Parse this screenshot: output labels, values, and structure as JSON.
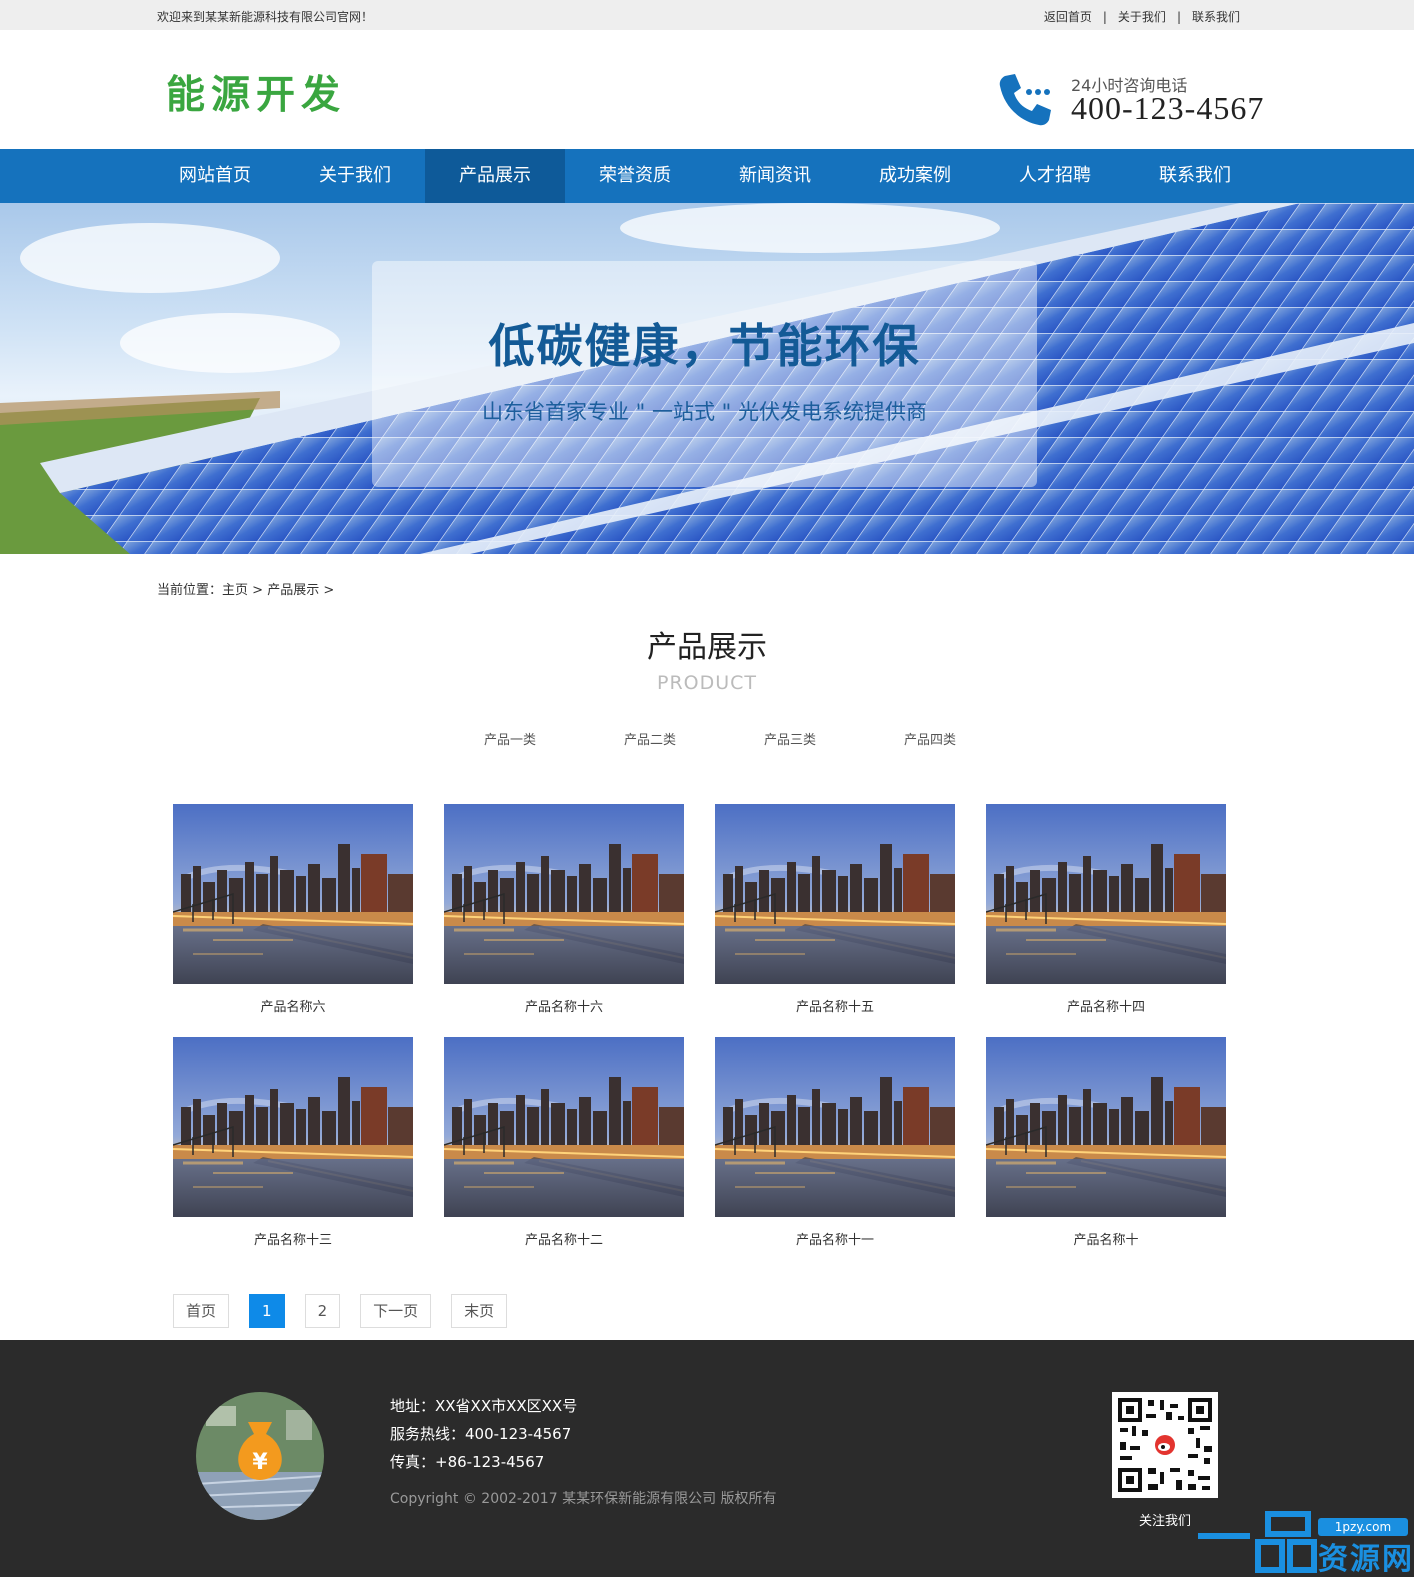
{
  "topbar": {
    "welcome": "欢迎来到某某新能源科技有限公司官网！",
    "links": [
      "返回首页",
      "关于我们",
      "联系我们"
    ],
    "separator": "|"
  },
  "header": {
    "logo": "能源开发",
    "phone_label": "24小时咨询电话",
    "phone_number": "400-123-4567"
  },
  "nav": {
    "items": [
      "网站首页",
      "关于我们",
      "产品展示",
      "荣誉资质",
      "新闻资讯",
      "成功案例",
      "人才招聘",
      "联系我们"
    ],
    "active": "产品展示"
  },
  "banner": {
    "title": "低碳健康，节能环保",
    "subtitle": "山东省首家专业 \" 一站式 \" 光伏发电系统提供商"
  },
  "breadcrumb": {
    "label": "当前位置：",
    "home": "主页",
    "current": "产品展示",
    "sep": ">"
  },
  "section": {
    "title": "产品展示",
    "subtitle": "PRODUCT"
  },
  "categories": [
    "产品一类",
    "产品二类",
    "产品三类",
    "产品四类"
  ],
  "products": [
    {
      "name": "产品名称六"
    },
    {
      "name": "产品名称十六"
    },
    {
      "name": "产品名称十五"
    },
    {
      "name": "产品名称十四"
    },
    {
      "name": "产品名称十三"
    },
    {
      "name": "产品名称十二"
    },
    {
      "name": "产品名称十一"
    },
    {
      "name": "产品名称十"
    }
  ],
  "pagination": {
    "first": "首页",
    "pages": [
      "1",
      "2"
    ],
    "current": "1",
    "next": "下一页",
    "last": "末页"
  },
  "footer": {
    "address": "地址：XX省XX市XX区XX号",
    "hotline": "服务热线：400-123-4567",
    "fax": "传真：+86-123-4567",
    "copyright": "Copyright © 2002-2017 某某环保新能源有限公司 版权所有",
    "qr_label": "关注我们",
    "watermark_badge": "1pzy.com",
    "watermark_text": "资源网"
  },
  "colors": {
    "nav_bg": "#1572bd",
    "nav_active": "#0e5a99",
    "logo_green": "#3aa640",
    "pager_current": "#0e8ae8",
    "footer_bg": "#2b2b2b"
  },
  "icons": {
    "phone": "phone-icon",
    "coin_bag": "money-bag-icon",
    "qr": "qr-code-icon"
  }
}
